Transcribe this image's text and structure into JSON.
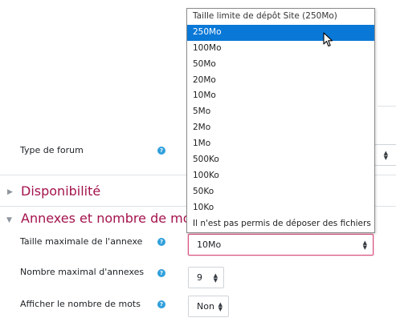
{
  "dropdown": {
    "options": [
      "Taille limite de dépôt Site (250Mo)",
      "250Mo",
      "100Mo",
      "50Mo",
      "20Mo",
      "10Mo",
      "5Mo",
      "2Mo",
      "1Mo",
      "500Ko",
      "100Ko",
      "50Ko",
      "10Ko",
      "Il n'est pas permis de déposer des fichiers"
    ],
    "highlighted_index": 1
  },
  "fields": {
    "forum_type_label": "Type de forum",
    "max_attachment_size_label": "Taille maximale de l'annexe",
    "max_attachment_size_value": "10Mo",
    "max_attachments_label": "Nombre maximal d'annexes",
    "max_attachments_value": "9",
    "show_word_count_label": "Afficher le nombre de mots",
    "show_word_count_value": "Non"
  },
  "sections": {
    "availability": "Disponibilité",
    "attachments": "Annexes et nombre de mots"
  },
  "help_glyph": "?",
  "colors": {
    "section_title": "#a3124c",
    "help_icon": "#2f9fdc",
    "highlight": "#0a78d7",
    "focus_border": "#d9507f"
  }
}
